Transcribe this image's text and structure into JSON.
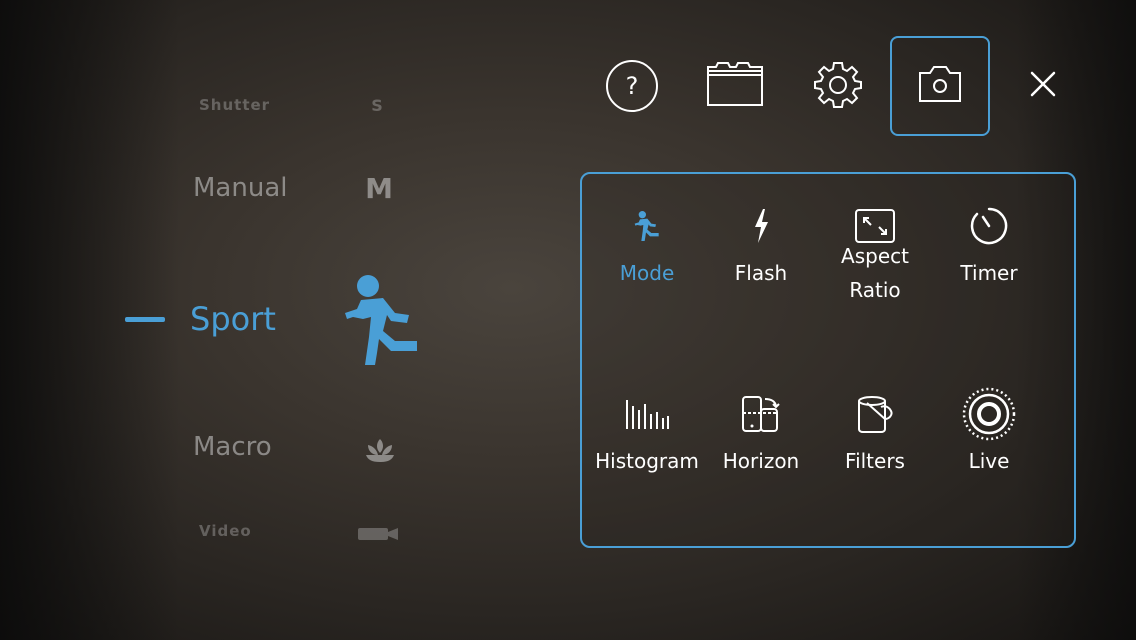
{
  "modes": {
    "shutter": {
      "label": "Shutter",
      "glyph": "S"
    },
    "manual": {
      "label": "Manual",
      "glyph": "M"
    },
    "sport": {
      "label": "Sport"
    },
    "macro": {
      "label": "Macro"
    },
    "video": {
      "label": "Video"
    }
  },
  "active_mode": "Sport",
  "toolbar": {
    "help_glyph": "?",
    "items": [
      "help-icon",
      "folder-icon",
      "gear-icon",
      "camera-icon",
      "close-icon"
    ],
    "active": "camera-icon"
  },
  "panel": {
    "items": [
      {
        "label": "Mode",
        "icon": "running-person-icon",
        "active": true
      },
      {
        "label": "Flash",
        "icon": "flash-icon"
      },
      {
        "label": "Aspect",
        "label2": "Ratio",
        "icon": "aspect-ratio-icon"
      },
      {
        "label": "Timer",
        "icon": "timer-icon"
      },
      {
        "label": "Histogram",
        "icon": "histogram-icon"
      },
      {
        "label": "Horizon",
        "icon": "horizon-icon"
      },
      {
        "label": "Filters",
        "icon": "filters-icon"
      },
      {
        "label": "Live",
        "icon": "live-icon"
      }
    ]
  },
  "colors": {
    "accent": "#4a9fd6",
    "text": "#ffffff"
  }
}
